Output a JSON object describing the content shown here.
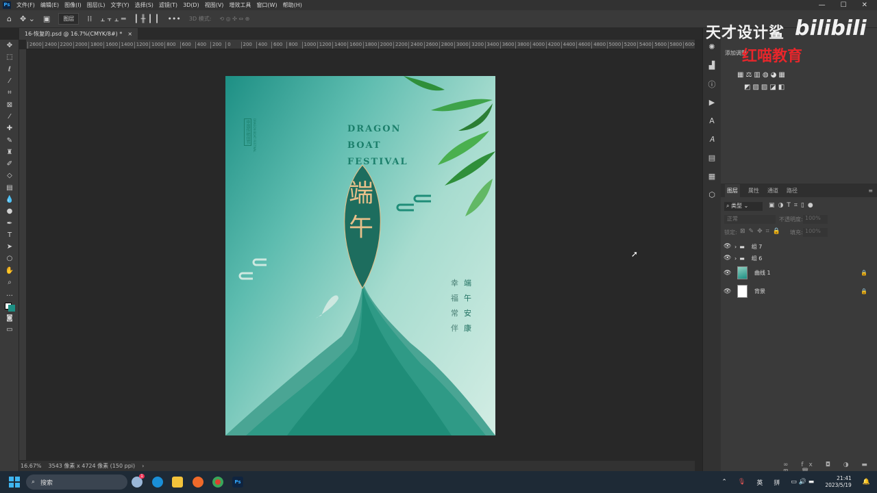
{
  "app": {
    "logo": "Ps",
    "menu": [
      "文件(F)",
      "编辑(E)",
      "图像(I)",
      "图层(L)",
      "文字(Y)",
      "选择(S)",
      "滤镜(T)",
      "3D(D)",
      "视图(V)",
      "增效工具",
      "窗口(W)",
      "帮助(H)"
    ],
    "window_controls": [
      "—",
      "☐",
      "✕"
    ]
  },
  "options_bar": {
    "layer_select": "图层",
    "mode_3d": "3D 模式:"
  },
  "document": {
    "tab_title": "16-恢复的.psd @ 16.7%(CMYK/8#) *",
    "close": "×"
  },
  "ruler_labels": [
    "2600",
    "2400",
    "2200",
    "2000",
    "1800",
    "1600",
    "1400",
    "1200",
    "1000",
    "800",
    "600",
    "400",
    "200",
    "0",
    "200",
    "400",
    "600",
    "800",
    "1000",
    "1200",
    "1400",
    "1600",
    "1800",
    "2000",
    "2200",
    "2400",
    "2600",
    "2800",
    "3000",
    "3200",
    "3400",
    "3600",
    "3800",
    "4000",
    "4200",
    "4400",
    "4600",
    "4800",
    "5000",
    "5200",
    "5400",
    "5600",
    "5800",
    "6000"
  ],
  "poster": {
    "title_lines": [
      "DRAGON",
      "BOAT",
      "FESTIVAL"
    ],
    "big_chars": [
      "端",
      "午"
    ],
    "stamp": "中国传统佳节",
    "side_en": "DRAGON BOAT FESTIVAL",
    "blessing_right": [
      "端",
      "午",
      "安",
      "康"
    ],
    "blessing_left": [
      "幸",
      "福",
      "常",
      "伴"
    ],
    "colors": {
      "teal": "#1d8f84",
      "gold": "#e8c08a"
    }
  },
  "status": {
    "zoom": "16.67%",
    "doc_info": "3543 像素 x 4724 像素 (150 ppi)",
    "arrow": "›"
  },
  "adjustments": {
    "label": "添加调整"
  },
  "layers_panel": {
    "tabs": [
      "图层",
      "属性",
      "通道",
      "路径"
    ],
    "filter": "类型",
    "blend": "正常",
    "opacity_label": "不透明度:",
    "opacity": "100%",
    "lock_label": "锁定:",
    "fill_label": "填充:",
    "fill": "100%",
    "layers": [
      {
        "name": "组 7",
        "type": "group",
        "visible": true
      },
      {
        "name": "组 6",
        "type": "group",
        "visible": true
      },
      {
        "name": "曲线 1",
        "type": "adjustment",
        "visible": true,
        "locked": true
      },
      {
        "name": "背景",
        "type": "background",
        "visible": true,
        "locked": true
      }
    ]
  },
  "watermark": {
    "channel": "天才设计鲨",
    "site": "bilibili",
    "brand": "红喵教育"
  },
  "taskbar": {
    "search": "搜索",
    "weather_badge": "1",
    "tray_lang": "英",
    "tray_ime": "拼",
    "time": "21:41",
    "date": "2023/5/19"
  }
}
